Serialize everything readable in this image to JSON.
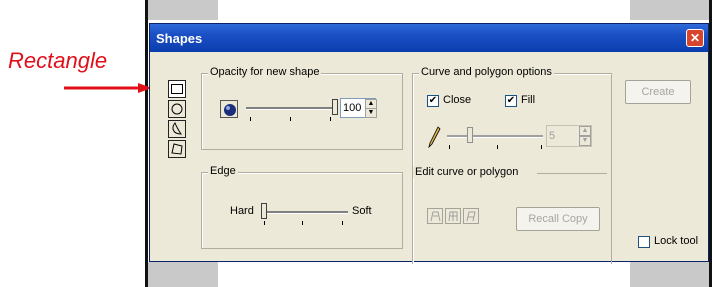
{
  "annotation": {
    "label": "Rectangle"
  },
  "dialog": {
    "title": "Shapes",
    "close_symbol": "✕",
    "tools": [
      {
        "name": "rectangle",
        "icon": "rectangle-icon"
      },
      {
        "name": "ellipse",
        "icon": "ellipse-icon"
      },
      {
        "name": "freeform",
        "icon": "freeform-icon"
      },
      {
        "name": "polygon",
        "icon": "polygon-icon"
      }
    ],
    "opacity": {
      "title": "Opacity for new shape",
      "value": "100",
      "level": 1.0
    },
    "edge": {
      "title": "Edge",
      "hard_label": "Hard",
      "soft_label": "Soft",
      "level": 0.0
    },
    "curve": {
      "title": "Curve and polygon options",
      "close_label": "Close",
      "close_checked": true,
      "fill_label": "Fill",
      "fill_checked": true,
      "points_value": "5"
    },
    "edit": {
      "title": "Edit curve or polygon",
      "recall_label": "Recall Copy"
    },
    "create_label": "Create",
    "lock_label": "Lock tool",
    "check_mark": "✔"
  },
  "colors": {
    "annotation": "#e0101a",
    "titlebar": "#0b3fae"
  }
}
